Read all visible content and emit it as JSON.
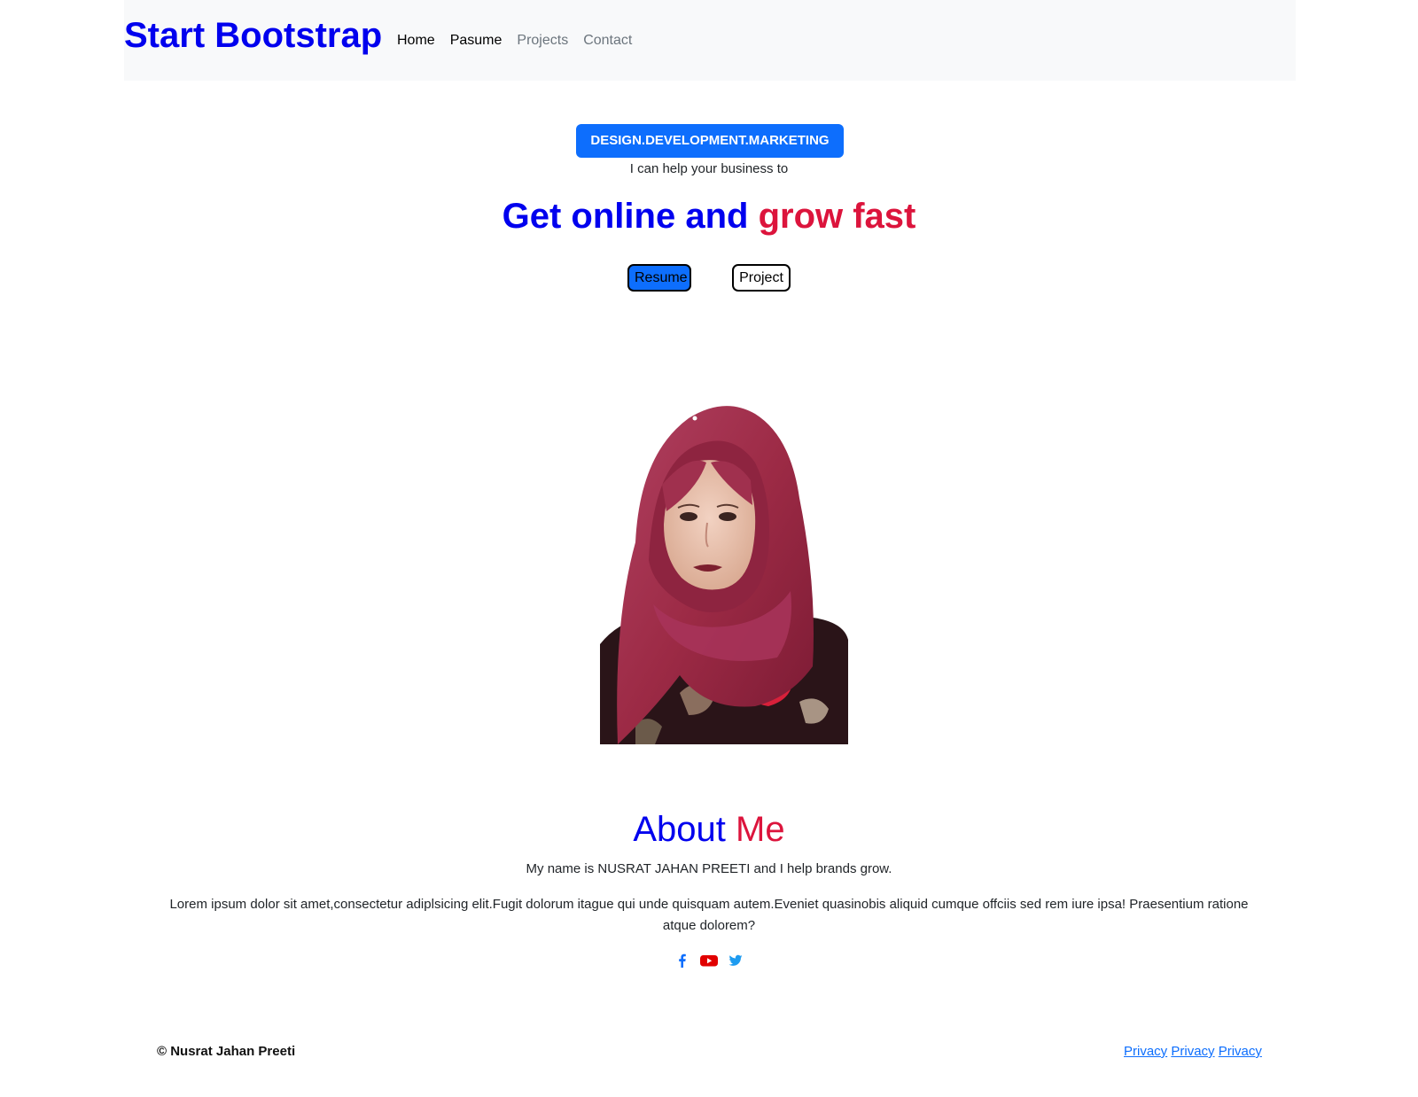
{
  "navbar": {
    "brand": "Start Bootstrap",
    "links": [
      {
        "label": "Home"
      },
      {
        "label": "Pasume"
      },
      {
        "label": "Projects"
      },
      {
        "label": "Contact"
      }
    ]
  },
  "hero": {
    "badge": "DESIGN.DEVELOPMENT.MARKETING",
    "subtitle": "I can help your business to",
    "headline_part1": "Get online and",
    "headline_part2": "grow fast",
    "buttons": {
      "resume": "Resume",
      "project": "Project"
    }
  },
  "about": {
    "title_part1": "About",
    "title_part2": "Me",
    "intro": "My name is NUSRAT JAHAN PREETI and I help brands grow.",
    "body": "Lorem ipsum dolor sit amet,consectetur adiplsicing elit.Fugit dolorum itague qui unde quisquam autem.Eveniet quasinobis aliquid cumque offciis sed rem iure ipsa! Praesentium ratione atque dolorem?",
    "social_icons": [
      "facebook-icon",
      "youtube-icon",
      "twitter-icon"
    ]
  },
  "footer": {
    "copyright": "© Nusrat Jahan Preeti",
    "links": [
      "Privacy",
      "Privacy",
      "Privacy"
    ]
  },
  "colors": {
    "brand_blue": "#0000ee",
    "accent_crimson": "#dc143c",
    "primary": "#0d6efd",
    "navbar_bg": "#f8f9fa"
  }
}
